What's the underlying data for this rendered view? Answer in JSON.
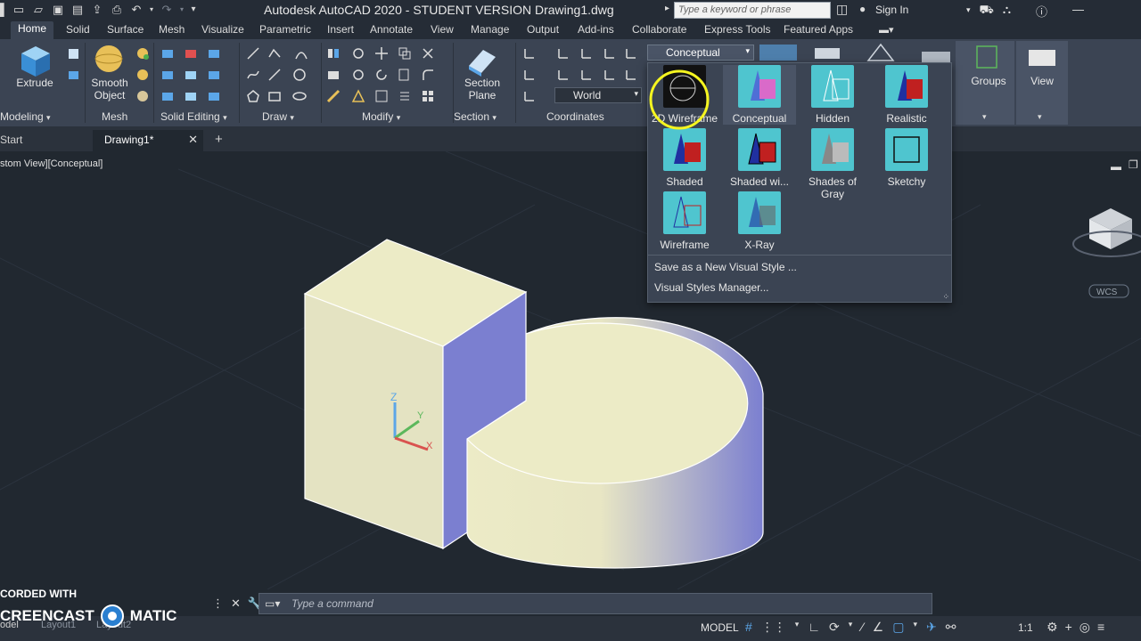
{
  "app": {
    "title": "Autodesk AutoCAD 2020 - STUDENT VERSION    Drawing1.dwg",
    "search_placeholder": "Type a keyword or phrase",
    "sign_in": "Sign In"
  },
  "ribbon_tabs": [
    "Home",
    "Solid",
    "Surface",
    "Mesh",
    "Visualize",
    "Parametric",
    "Insert",
    "Annotate",
    "View",
    "Manage",
    "Output",
    "Add-ins",
    "Collaborate",
    "Express Tools",
    "Featured Apps"
  ],
  "ribbon": {
    "extrude": "Extrude",
    "smooth_object": "Smooth Object",
    "section_plane": "Section Plane",
    "world": "World",
    "visual_style": "Conceptual",
    "groups": "Groups",
    "view": "View",
    "panels": [
      "Modeling",
      "Mesh",
      "Solid Editing",
      "Draw",
      "Modify",
      "Section",
      "Coordinates"
    ]
  },
  "file_tabs": {
    "start": "Start",
    "drawing": "Drawing1*",
    "add": "+"
  },
  "viewport": {
    "label": "stom View][Conceptual]",
    "wcs": "WCS",
    "axis_z": "Z",
    "axis_y": "Y",
    "axis_x": "X"
  },
  "visual_styles": [
    {
      "label": "2D Wireframe",
      "icon": "wireframe-2d"
    },
    {
      "label": "Conceptual",
      "icon": "conceptual"
    },
    {
      "label": "Hidden",
      "icon": "hidden"
    },
    {
      "label": "Realistic",
      "icon": "realistic"
    },
    {
      "label": "Shaded",
      "icon": "shaded"
    },
    {
      "label": "Shaded wi...",
      "icon": "shaded-edges"
    },
    {
      "label": "Shades of Gray",
      "icon": "shades-gray"
    },
    {
      "label": "Sketchy",
      "icon": "sketchy"
    },
    {
      "label": "Wireframe",
      "icon": "wireframe"
    },
    {
      "label": "X-Ray",
      "icon": "xray"
    }
  ],
  "menu": {
    "save_new": "Save as a New Visual Style ...",
    "manager": "Visual Styles Manager..."
  },
  "command": {
    "placeholder": "Type  a  command"
  },
  "status": {
    "model": "MODEL",
    "scale": "1:1",
    "layouts": [
      "odel",
      "Layout1",
      "Layout2"
    ]
  },
  "watermark": {
    "line1": "CORDED WITH",
    "line2a": "CREENCAST",
    "line2b": "MATIC"
  },
  "colors": {
    "accent": "#4a90d9",
    "face_light": "#ecebc6",
    "face_side": "#7b7fd0",
    "highlight_circle": "#f5f520"
  }
}
